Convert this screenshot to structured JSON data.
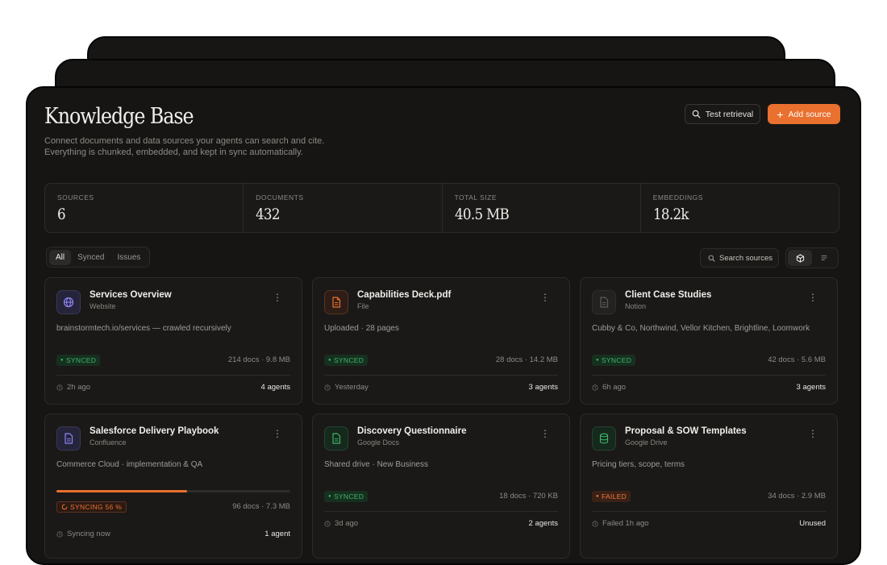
{
  "header": {
    "title": "Knowledge Base",
    "subtitle_line1": "Connect documents and data sources your agents can search and cite.",
    "subtitle_line2": "Everything is chunked, embedded, and kept in sync automatically.",
    "test_label": "Test retrieval",
    "add_label": "Add source"
  },
  "stats": [
    {
      "label": "SOURCES",
      "value": "6"
    },
    {
      "label": "DOCUMENTS",
      "value": "432"
    },
    {
      "label": "TOTAL SIZE",
      "value": "40.5 MB"
    },
    {
      "label": "EMBEDDINGS",
      "value": "18.2k"
    }
  ],
  "filters": [
    "All",
    "Synced",
    "Issues"
  ],
  "search": {
    "label": "Search sources"
  },
  "colors": {
    "accent": "#e9702e",
    "synced": "#3fb36a",
    "failed": "#ec7a3e"
  },
  "cards": [
    {
      "name": "Services Overview",
      "type": "Website",
      "icon": "globe-icon",
      "desc": "brainstormtech.io/services — crawled recursively",
      "status": "SYNCED",
      "stats": "214 docs · 9.8 MB",
      "time": "2h ago",
      "agents": "4 agents"
    },
    {
      "name": "Capabilities Deck.pdf",
      "type": "File",
      "icon": "file-icon",
      "desc": "Uploaded · 28 pages",
      "status": "SYNCED",
      "stats": "28 docs · 14.2 MB",
      "time": "Yesterday",
      "agents": "3 agents"
    },
    {
      "name": "Client Case Studies",
      "type": "Notion",
      "icon": "notion-doc-icon",
      "desc": "Cubby & Co, Northwind, Vellor Kitchen, Brightline, Loomwork",
      "status": "SYNCED",
      "stats": "42 docs · 5.6 MB",
      "time": "6h ago",
      "agents": "3 agents"
    },
    {
      "name": "Salesforce Delivery Playbook",
      "type": "Confluence",
      "icon": "confluence-doc-icon",
      "desc": "Commerce Cloud · implementation & QA",
      "status": "SYNCING 56 %",
      "progress": 0.56,
      "stats": "96 docs · 7.3 MB",
      "time": "Syncing now",
      "agents": "1 agent"
    },
    {
      "name": "Discovery Questionnaire",
      "type": "Google Docs",
      "icon": "google-doc-icon",
      "desc": "Shared drive · New Business",
      "status": "SYNCED",
      "stats": "18 docs · 720 KB",
      "time": "3d ago",
      "agents": "2 agents"
    },
    {
      "name": "Proposal & SOW Templates",
      "type": "Google Drive",
      "icon": "database-icon",
      "desc": "Pricing tiers, scope, terms",
      "status": "FAILED",
      "stats": "34 docs · 2.9 MB",
      "time": "Failed 1h ago",
      "agents": "Unused"
    }
  ]
}
